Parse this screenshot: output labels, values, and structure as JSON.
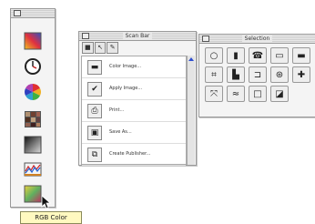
{
  "toolbox": {
    "tools": [
      {
        "name": "gradient-tool"
      },
      {
        "name": "clock-tool"
      },
      {
        "name": "color-wheel-tool"
      },
      {
        "name": "grid-tool"
      },
      {
        "name": "gray-gradient-tool"
      },
      {
        "name": "rgb-levels-tool"
      },
      {
        "name": "rgb-color-tool"
      }
    ]
  },
  "actions": {
    "title": "Scan Bar",
    "items": [
      {
        "label": "Color Image...",
        "icon": "color-image-icon"
      },
      {
        "label": "Apply Image...",
        "icon": "checkmark-icon"
      },
      {
        "label": "Print...",
        "icon": "print-icon"
      },
      {
        "label": "Save As...",
        "icon": "save-icon"
      },
      {
        "label": "Create Publisher...",
        "icon": "publisher-icon"
      }
    ]
  },
  "selection": {
    "title": "Selection",
    "tools": [
      "circle-icon",
      "rectangle-icon",
      "phone-icon",
      "monitor-icon",
      "panel-icon",
      "crop-icon",
      "stack-icon",
      "bracket-icon",
      "magic-icon",
      "plus-icon",
      "expand-icon",
      "wave-icon",
      "square-icon",
      "layers-icon"
    ]
  },
  "tooltip": {
    "text": "RGB Color"
  }
}
